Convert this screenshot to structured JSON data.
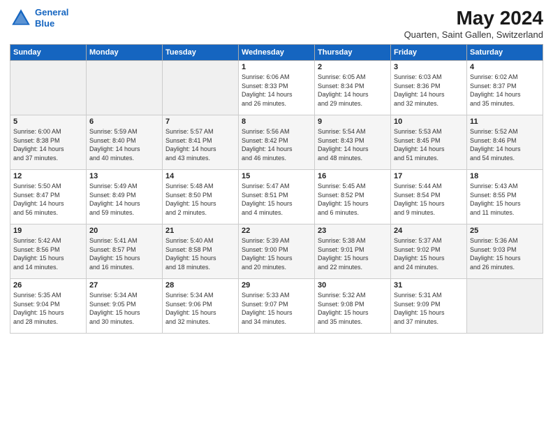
{
  "header": {
    "logo_line1": "General",
    "logo_line2": "Blue",
    "month_title": "May 2024",
    "location": "Quarten, Saint Gallen, Switzerland"
  },
  "days_of_week": [
    "Sunday",
    "Monday",
    "Tuesday",
    "Wednesday",
    "Thursday",
    "Friday",
    "Saturday"
  ],
  "weeks": [
    [
      {
        "day": "",
        "info": ""
      },
      {
        "day": "",
        "info": ""
      },
      {
        "day": "",
        "info": ""
      },
      {
        "day": "1",
        "info": "Sunrise: 6:06 AM\nSunset: 8:33 PM\nDaylight: 14 hours\nand 26 minutes."
      },
      {
        "day": "2",
        "info": "Sunrise: 6:05 AM\nSunset: 8:34 PM\nDaylight: 14 hours\nand 29 minutes."
      },
      {
        "day": "3",
        "info": "Sunrise: 6:03 AM\nSunset: 8:36 PM\nDaylight: 14 hours\nand 32 minutes."
      },
      {
        "day": "4",
        "info": "Sunrise: 6:02 AM\nSunset: 8:37 PM\nDaylight: 14 hours\nand 35 minutes."
      }
    ],
    [
      {
        "day": "5",
        "info": "Sunrise: 6:00 AM\nSunset: 8:38 PM\nDaylight: 14 hours\nand 37 minutes."
      },
      {
        "day": "6",
        "info": "Sunrise: 5:59 AM\nSunset: 8:40 PM\nDaylight: 14 hours\nand 40 minutes."
      },
      {
        "day": "7",
        "info": "Sunrise: 5:57 AM\nSunset: 8:41 PM\nDaylight: 14 hours\nand 43 minutes."
      },
      {
        "day": "8",
        "info": "Sunrise: 5:56 AM\nSunset: 8:42 PM\nDaylight: 14 hours\nand 46 minutes."
      },
      {
        "day": "9",
        "info": "Sunrise: 5:54 AM\nSunset: 8:43 PM\nDaylight: 14 hours\nand 48 minutes."
      },
      {
        "day": "10",
        "info": "Sunrise: 5:53 AM\nSunset: 8:45 PM\nDaylight: 14 hours\nand 51 minutes."
      },
      {
        "day": "11",
        "info": "Sunrise: 5:52 AM\nSunset: 8:46 PM\nDaylight: 14 hours\nand 54 minutes."
      }
    ],
    [
      {
        "day": "12",
        "info": "Sunrise: 5:50 AM\nSunset: 8:47 PM\nDaylight: 14 hours\nand 56 minutes."
      },
      {
        "day": "13",
        "info": "Sunrise: 5:49 AM\nSunset: 8:49 PM\nDaylight: 14 hours\nand 59 minutes."
      },
      {
        "day": "14",
        "info": "Sunrise: 5:48 AM\nSunset: 8:50 PM\nDaylight: 15 hours\nand 2 minutes."
      },
      {
        "day": "15",
        "info": "Sunrise: 5:47 AM\nSunset: 8:51 PM\nDaylight: 15 hours\nand 4 minutes."
      },
      {
        "day": "16",
        "info": "Sunrise: 5:45 AM\nSunset: 8:52 PM\nDaylight: 15 hours\nand 6 minutes."
      },
      {
        "day": "17",
        "info": "Sunrise: 5:44 AM\nSunset: 8:54 PM\nDaylight: 15 hours\nand 9 minutes."
      },
      {
        "day": "18",
        "info": "Sunrise: 5:43 AM\nSunset: 8:55 PM\nDaylight: 15 hours\nand 11 minutes."
      }
    ],
    [
      {
        "day": "19",
        "info": "Sunrise: 5:42 AM\nSunset: 8:56 PM\nDaylight: 15 hours\nand 14 minutes."
      },
      {
        "day": "20",
        "info": "Sunrise: 5:41 AM\nSunset: 8:57 PM\nDaylight: 15 hours\nand 16 minutes."
      },
      {
        "day": "21",
        "info": "Sunrise: 5:40 AM\nSunset: 8:58 PM\nDaylight: 15 hours\nand 18 minutes."
      },
      {
        "day": "22",
        "info": "Sunrise: 5:39 AM\nSunset: 9:00 PM\nDaylight: 15 hours\nand 20 minutes."
      },
      {
        "day": "23",
        "info": "Sunrise: 5:38 AM\nSunset: 9:01 PM\nDaylight: 15 hours\nand 22 minutes."
      },
      {
        "day": "24",
        "info": "Sunrise: 5:37 AM\nSunset: 9:02 PM\nDaylight: 15 hours\nand 24 minutes."
      },
      {
        "day": "25",
        "info": "Sunrise: 5:36 AM\nSunset: 9:03 PM\nDaylight: 15 hours\nand 26 minutes."
      }
    ],
    [
      {
        "day": "26",
        "info": "Sunrise: 5:35 AM\nSunset: 9:04 PM\nDaylight: 15 hours\nand 28 minutes."
      },
      {
        "day": "27",
        "info": "Sunrise: 5:34 AM\nSunset: 9:05 PM\nDaylight: 15 hours\nand 30 minutes."
      },
      {
        "day": "28",
        "info": "Sunrise: 5:34 AM\nSunset: 9:06 PM\nDaylight: 15 hours\nand 32 minutes."
      },
      {
        "day": "29",
        "info": "Sunrise: 5:33 AM\nSunset: 9:07 PM\nDaylight: 15 hours\nand 34 minutes."
      },
      {
        "day": "30",
        "info": "Sunrise: 5:32 AM\nSunset: 9:08 PM\nDaylight: 15 hours\nand 35 minutes."
      },
      {
        "day": "31",
        "info": "Sunrise: 5:31 AM\nSunset: 9:09 PM\nDaylight: 15 hours\nand 37 minutes."
      },
      {
        "day": "",
        "info": ""
      }
    ]
  ]
}
